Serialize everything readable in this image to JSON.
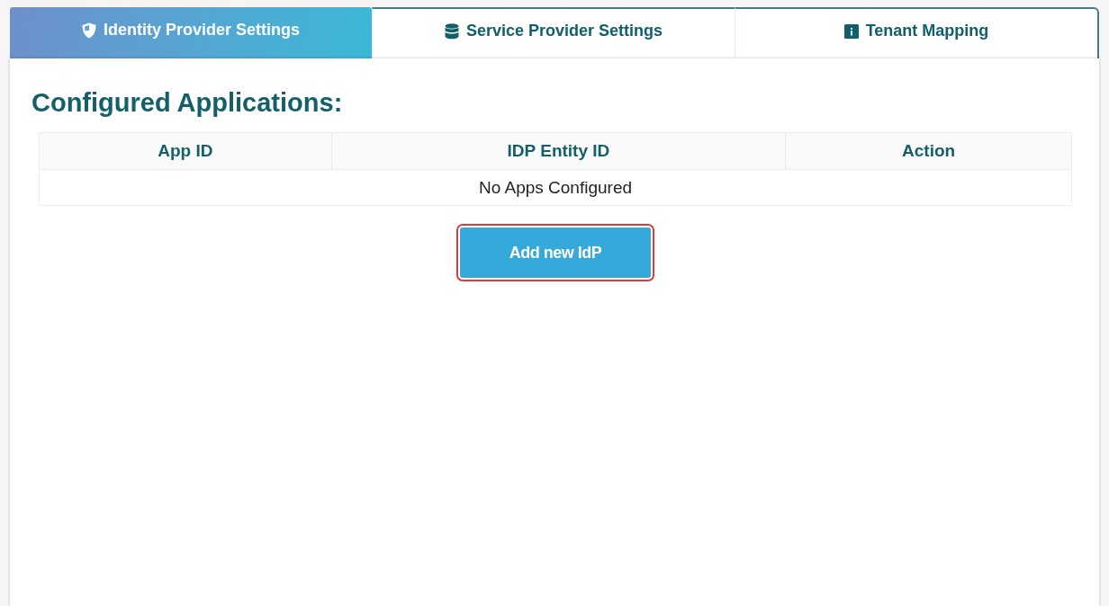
{
  "tabs": [
    {
      "label": "Identity Provider Settings",
      "selected": true
    },
    {
      "label": "Service Provider Settings",
      "selected": false
    },
    {
      "label": "Tenant Mapping",
      "selected": false
    }
  ],
  "panel": {
    "heading": "Configured Applications:",
    "table": {
      "columns": [
        "App ID",
        "IDP Entity ID",
        "Action"
      ],
      "empty_message": "No Apps Configured"
    },
    "add_button": {
      "label": "Add new IdP",
      "highlighted": true
    }
  }
}
